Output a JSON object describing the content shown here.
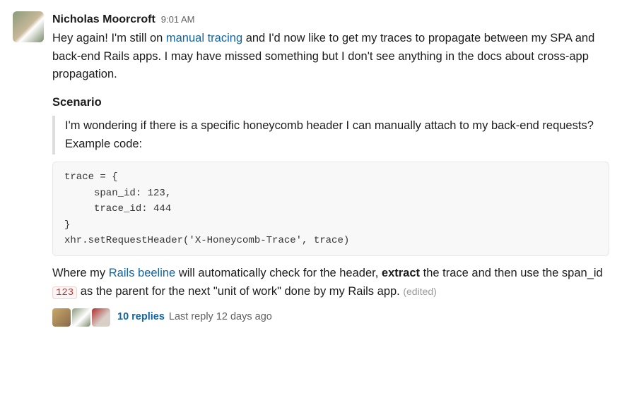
{
  "message": {
    "author": "Nicholas Moorcroft",
    "timestamp": "9:01 AM",
    "intro_pre": "Hey again! I'm still on ",
    "intro_link": "manual tracing",
    "intro_post": " and I'd now like to get my traces to propagate between my SPA and back-end Rails apps. I may have missed something but I don't see anything in the docs about cross-app propagation.",
    "section_title": "Scenario",
    "quote": "I'm wondering if there is a specific honeycomb header I can manually attach to my back-end requests? Example code:",
    "code": "trace = {\n     span_id: 123,\n     trace_id: 444\n}\nxhr.setRequestHeader('X-Honeycomb-Trace', trace)",
    "outro_pre": "Where my ",
    "outro_link": "Rails beeline",
    "outro_mid1": " will automatically check for the header, ",
    "outro_bold": "extract",
    "outro_mid2": " the trace and then use the span_id ",
    "outro_code": "123",
    "outro_post": " as the parent for the next \"unit of work\" done by my Rails app. ",
    "edited": "(edited)"
  },
  "thread": {
    "replies_label": "10 replies",
    "last_reply": "Last reply 12 days ago"
  }
}
